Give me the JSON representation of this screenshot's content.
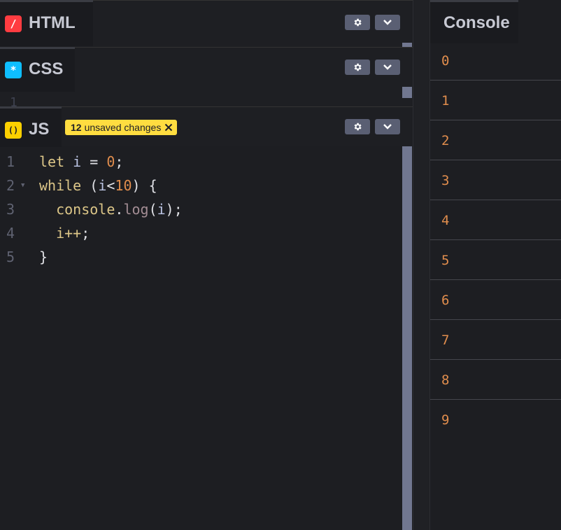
{
  "panels": {
    "html": {
      "title": "HTML",
      "icon": "slash-icon",
      "icon_glyph": "/",
      "accent": "#ff3c41"
    },
    "css": {
      "title": "CSS",
      "icon": "asterisk-icon",
      "icon_glyph": "*",
      "accent": "#0ebeff"
    },
    "js": {
      "title": "JS",
      "icon": "parentheses-icon",
      "icon_glyph": "()",
      "accent": "#fcd000",
      "unsaved_count": "12",
      "unsaved_text": "unsaved changes"
    }
  },
  "css_gutter_line": "1",
  "code": {
    "lines": [
      {
        "n": "1",
        "tokens": [
          [
            "kw",
            "let"
          ],
          [
            "punc",
            " "
          ],
          [
            "var",
            "i"
          ],
          [
            "punc",
            " = "
          ],
          [
            "num",
            "0"
          ],
          [
            "punc",
            ";"
          ]
        ]
      },
      {
        "n": "2",
        "tokens": [
          [
            "kw",
            "while"
          ],
          [
            "punc",
            " ("
          ],
          [
            "var",
            "i"
          ],
          [
            "punc",
            "<"
          ],
          [
            "num",
            "10"
          ],
          [
            "punc",
            ") {"
          ]
        ]
      },
      {
        "n": "3",
        "tokens": [
          [
            "punc",
            "  "
          ],
          [
            "kw",
            "console"
          ],
          [
            "punc",
            "."
          ],
          [
            "fn",
            "log"
          ],
          [
            "punc",
            "("
          ],
          [
            "var",
            "i"
          ],
          [
            "punc",
            ");"
          ]
        ]
      },
      {
        "n": "4",
        "tokens": [
          [
            "punc",
            "  "
          ],
          [
            "kw",
            "i++"
          ],
          [
            "punc",
            ";"
          ]
        ]
      },
      {
        "n": "5",
        "tokens": [
          [
            "punc",
            "}"
          ]
        ]
      }
    ]
  },
  "console": {
    "title": "Console",
    "output": [
      "0",
      "1",
      "2",
      "3",
      "4",
      "5",
      "6",
      "7",
      "8",
      "9"
    ]
  },
  "icons": {
    "settings": "gear-icon",
    "collapse": "chevron-down-icon",
    "close": "close-icon",
    "fold": "fold-triangle-icon"
  }
}
